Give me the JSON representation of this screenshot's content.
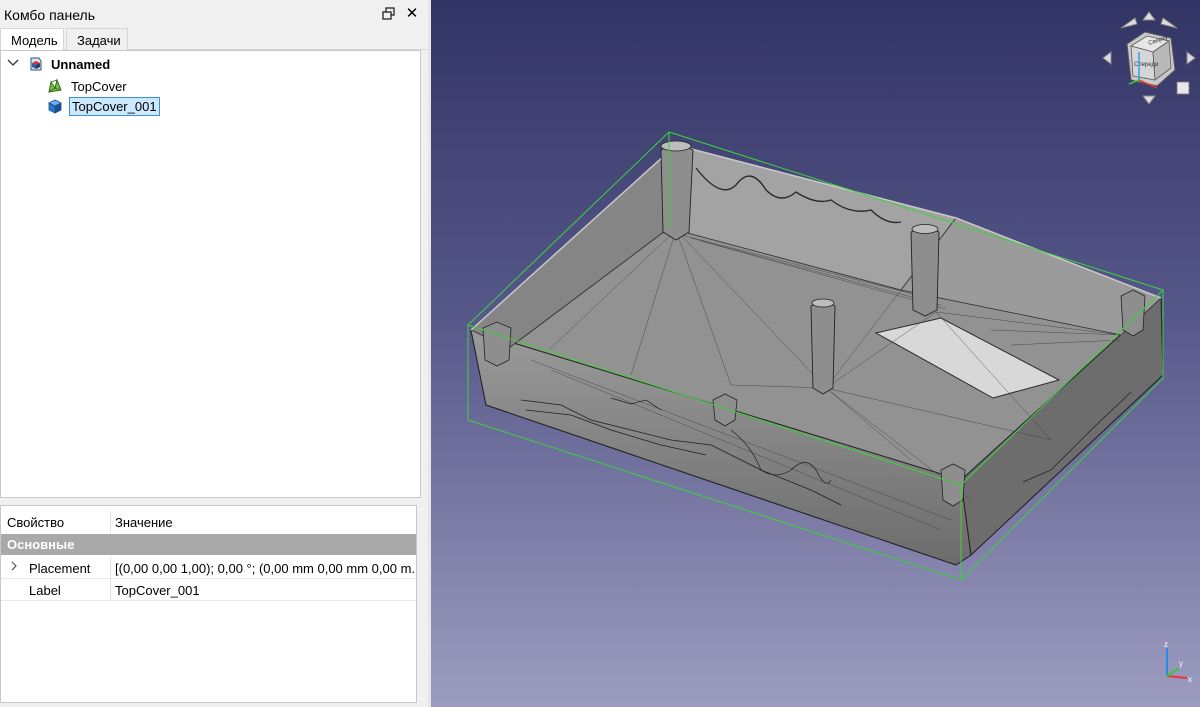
{
  "combo_panel": {
    "title": "Комбо панель",
    "tabs": [
      {
        "label": "Модель",
        "active": true
      },
      {
        "label": "Задачи",
        "active": false
      }
    ]
  },
  "tree": {
    "root": {
      "label": "Unnamed",
      "icon": "document-icon",
      "expanded": true
    },
    "items": [
      {
        "label": "TopCover",
        "icon": "mesh-icon",
        "selected": false
      },
      {
        "label": "TopCover_001",
        "icon": "part-box-icon",
        "selected": true
      }
    ]
  },
  "properties": {
    "headers": {
      "property": "Свойство",
      "value": "Значение"
    },
    "group": "Основные",
    "rows": [
      {
        "name": "Placement",
        "value": "[(0,00 0,00 1,00); 0,00 °; (0,00 mm  0,00 mm  0,00 m...",
        "expandable": true
      },
      {
        "name": "Label",
        "value": "TopCover_001",
        "expandable": false
      }
    ]
  },
  "navigation_cube": {
    "faces": [
      "Сверху",
      "Спереди"
    ],
    "axes": [
      "x",
      "y",
      "z"
    ]
  },
  "corner_axes": {
    "labels": [
      "z",
      "y",
      "x"
    ]
  },
  "colors": {
    "view_top": "#323464",
    "view_bottom": "#9d9cc0",
    "model_fill": "#8a8a8a",
    "bbox": "#3cd23c",
    "selection": "#cce8ff"
  }
}
